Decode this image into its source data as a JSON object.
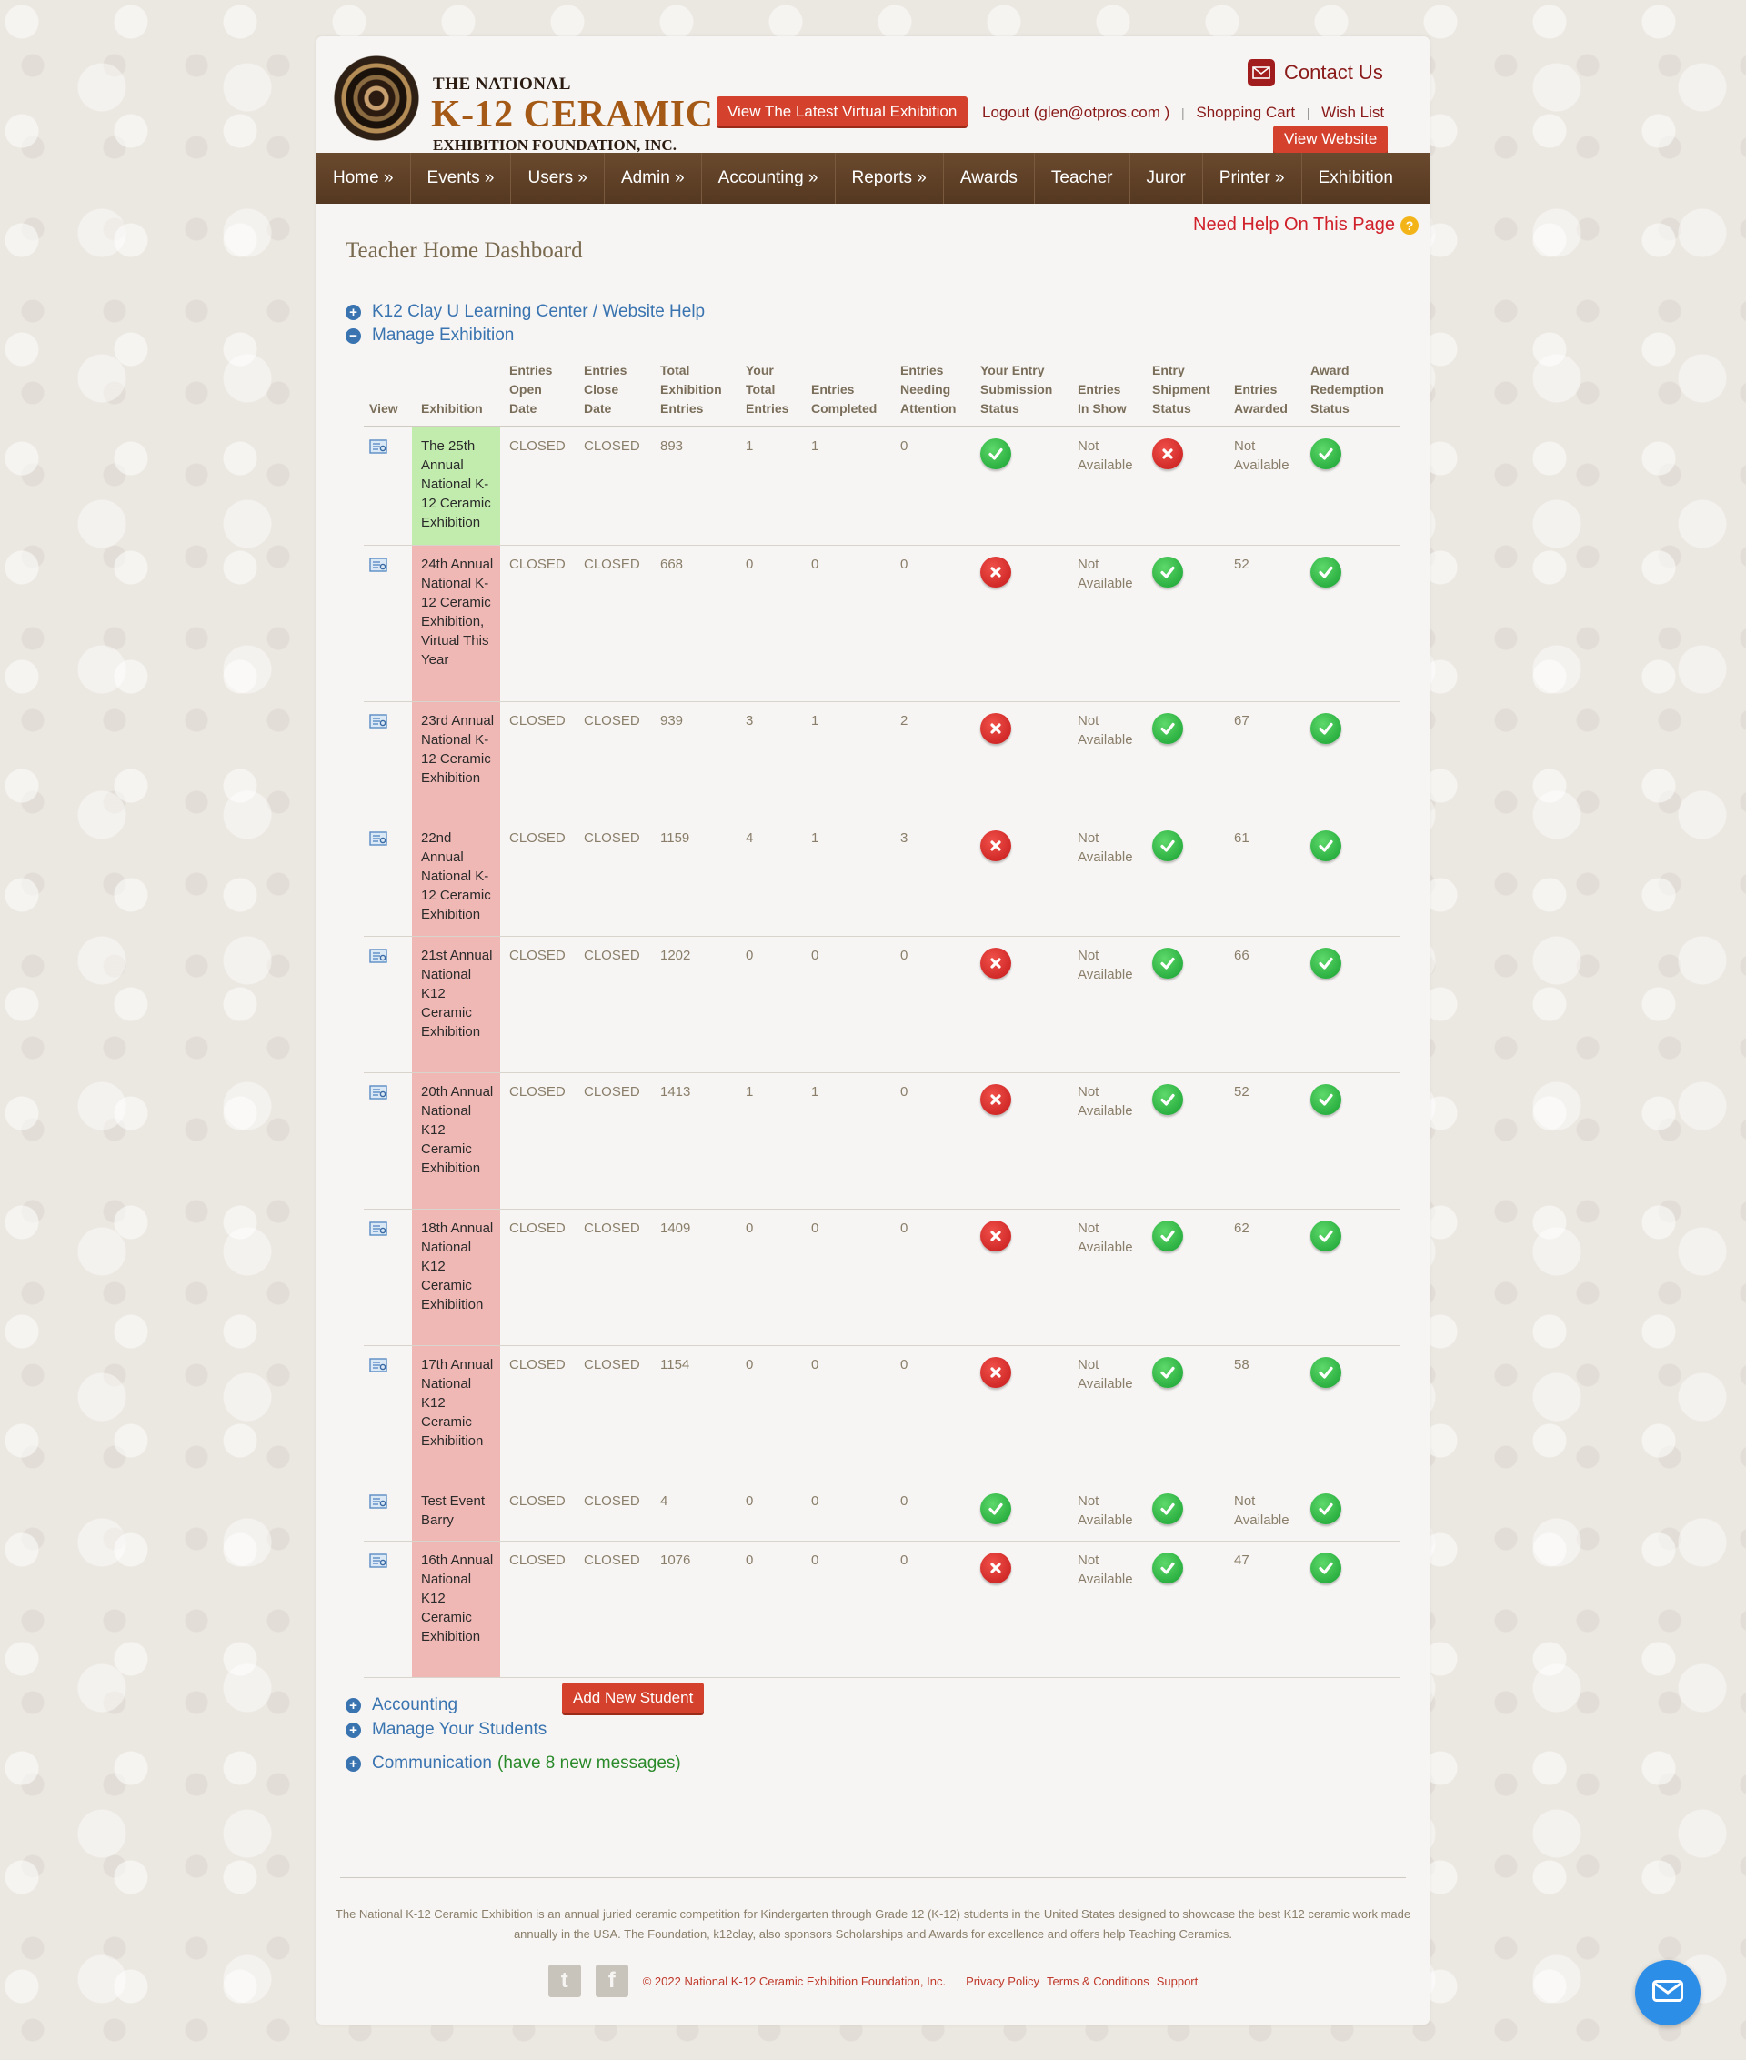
{
  "header": {
    "logo_line1": "THE NATIONAL",
    "logo_line2": "K-12 CERAMIC",
    "logo_line3": "EXHIBITION FOUNDATION, INC.",
    "virtual_exhibition_button": "View The Latest Virtual Exhibition",
    "contact_label": "Contact Us",
    "logout_label": "Logout (glen@otpros.com )",
    "separator": "|",
    "cart_label": "Shopping Cart",
    "wishlist_label": "Wish List",
    "view_website_button": "View Website"
  },
  "nav": [
    "Home »",
    "Events »",
    "Users »",
    "Admin »",
    "Accounting »",
    "Reports »",
    "Awards",
    "Teacher",
    "Juror",
    "Printer »",
    "Exhibition"
  ],
  "help_link": "Need Help On This Page",
  "help_icon_glyph": "?",
  "page_title": "Teacher Home Dashboard",
  "sections": {
    "learning_center": "K12 Clay U Learning Center / Website Help",
    "manage_exhibition": "Manage Exhibition",
    "accounting": "Accounting",
    "manage_students": "Manage Your Students",
    "add_student_button": "Add New Student",
    "communication": "Communication",
    "communication_note": "(have 8 new messages)"
  },
  "table": {
    "headers": {
      "view": "View",
      "exhibition": "Exhibition",
      "open": "Entries\nOpen\nDate",
      "close": "Entries\nClose\nDate",
      "total": "Total\nExhibition\nEntries",
      "your": "Your\nTotal\nEntries",
      "completed": "Entries\nCompleted",
      "needing": "Entries\nNeeding\nAttention",
      "submission": "Your Entry\nSubmission\nStatus",
      "in_show": "Entries\nIn Show",
      "shipment": "Entry\nShipment\nStatus",
      "awarded": "Entries\nAwarded",
      "redemption": "Award\nRedemption\nStatus"
    },
    "rows": [
      {
        "exhibition": "The 25th Annual National K-12 Ceramic Exhibition",
        "highlight": "green",
        "open": "CLOSED",
        "close": "CLOSED",
        "total": "893",
        "your": "1",
        "completed": "1",
        "needing": "0",
        "submission": "ok",
        "in_show": "Not Available",
        "shipment": "bad",
        "awarded": "Not Available",
        "redemption": "ok"
      },
      {
        "exhibition": "24th Annual National K-12 Ceramic Exhibition, Virtual This Year",
        "highlight": "red",
        "open": "CLOSED",
        "close": "CLOSED",
        "total": "668",
        "your": "0",
        "completed": "0",
        "needing": "0",
        "submission": "bad",
        "in_show": "Not Available",
        "shipment": "ok",
        "awarded": "52",
        "redemption": "ok"
      },
      {
        "exhibition": "23rd Annual National K-12 Ceramic Exhibition",
        "highlight": "red",
        "open": "CLOSED",
        "close": "CLOSED",
        "total": "939",
        "your": "3",
        "completed": "1",
        "needing": "2",
        "submission": "bad",
        "in_show": "Not Available",
        "shipment": "ok",
        "awarded": "67",
        "redemption": "ok"
      },
      {
        "exhibition": "22nd Annual National K-12 Ceramic Exhibition",
        "highlight": "red",
        "open": "CLOSED",
        "close": "CLOSED",
        "total": "1159",
        "your": "4",
        "completed": "1",
        "needing": "3",
        "submission": "bad",
        "in_show": "Not Available",
        "shipment": "ok",
        "awarded": "61",
        "redemption": "ok"
      },
      {
        "exhibition": "21st Annual National K12 Ceramic Exhibition",
        "highlight": "red",
        "open": "CLOSED",
        "close": "CLOSED",
        "total": "1202",
        "your": "0",
        "completed": "0",
        "needing": "0",
        "submission": "bad",
        "in_show": "Not Available",
        "shipment": "ok",
        "awarded": "66",
        "redemption": "ok"
      },
      {
        "exhibition": "20th Annual National K12 Ceramic Exhibition",
        "highlight": "red",
        "open": "CLOSED",
        "close": "CLOSED",
        "total": "1413",
        "your": "1",
        "completed": "1",
        "needing": "0",
        "submission": "bad",
        "in_show": "Not Available",
        "shipment": "ok",
        "awarded": "52",
        "redemption": "ok"
      },
      {
        "exhibition": "18th Annual National K12 Ceramic Exhibiition",
        "highlight": "red",
        "open": "CLOSED",
        "close": "CLOSED",
        "total": "1409",
        "your": "0",
        "completed": "0",
        "needing": "0",
        "submission": "bad",
        "in_show": "Not Available",
        "shipment": "ok",
        "awarded": "62",
        "redemption": "ok"
      },
      {
        "exhibition": "17th Annual National K12 Ceramic Exhibiition",
        "highlight": "red",
        "open": "CLOSED",
        "close": "CLOSED",
        "total": "1154",
        "your": "0",
        "completed": "0",
        "needing": "0",
        "submission": "bad",
        "in_show": "Not Available",
        "shipment": "ok",
        "awarded": "58",
        "redemption": "ok"
      },
      {
        "exhibition": "Test Event Barry",
        "highlight": "red",
        "open": "CLOSED",
        "close": "CLOSED",
        "total": "4",
        "your": "0",
        "completed": "0",
        "needing": "0",
        "submission": "ok",
        "in_show": "Not Available",
        "shipment": "ok",
        "awarded": "Not Available",
        "redemption": "ok"
      },
      {
        "exhibition": "16th Annual National K12 Ceramic Exhibition",
        "highlight": "red",
        "open": "CLOSED",
        "close": "CLOSED",
        "total": "1076",
        "your": "0",
        "completed": "0",
        "needing": "0",
        "submission": "bad",
        "in_show": "Not Available",
        "shipment": "ok",
        "awarded": "47",
        "redemption": "ok"
      }
    ]
  },
  "footer": {
    "description": "The National K-12 Ceramic Exhibition is an annual juried ceramic competition for Kindergarten through Grade 12 (K-12) students in the United States designed to showcase the best K12 ceramic work made annually in the USA. The Foundation, k12clay, also sponsors Scholarships and Awards for excellence and offers help Teaching Ceramics.",
    "copyright": "© 2022 National K-12 Ceramic Exhibition Foundation, Inc.",
    "privacy": "Privacy Policy",
    "terms": "Terms & Conditions",
    "support": "Support"
  },
  "colors": {
    "accent_red": "#d4412c",
    "nav_brown": "#5e4028",
    "link_blue": "#3a74b0",
    "status_ok": "#1fa83a",
    "status_bad": "#d42020",
    "row_green": "#c2ecad",
    "row_red": "#f0b8b5"
  },
  "icons": {
    "view": "document-view-icon",
    "expand": "plus-circle-icon",
    "collapse": "minus-circle-icon",
    "ok": "check-circle-icon",
    "bad": "x-circle-icon",
    "contact": "envelope-icon",
    "chat": "envelope-icon"
  }
}
